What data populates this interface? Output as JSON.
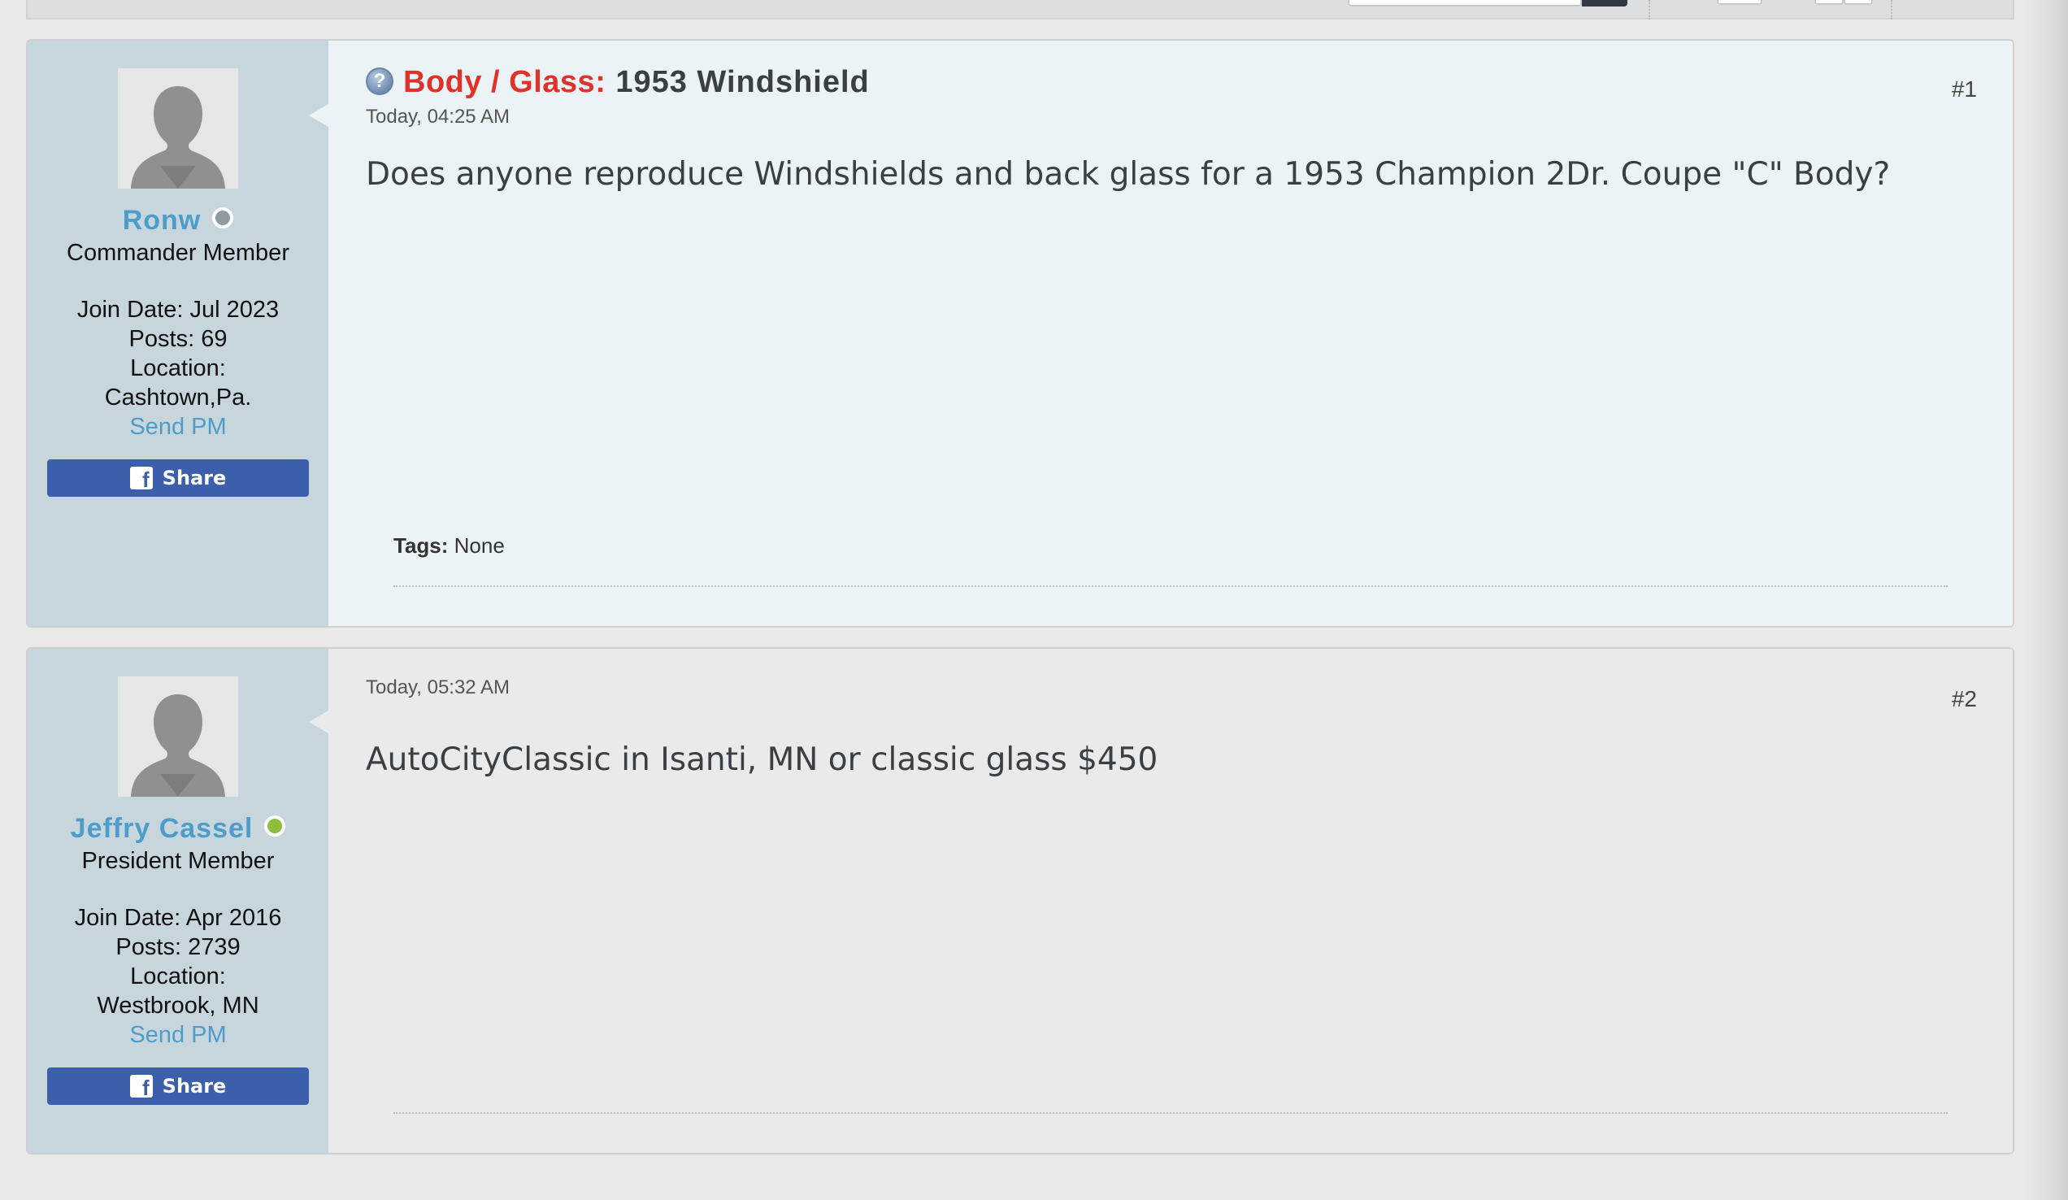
{
  "colors": {
    "username": "#4d9cc9",
    "prefix": "#e0322b",
    "share_button": "#3b5fab",
    "status_online": "#8bbf3b",
    "status_offline": "#8f9aa1"
  },
  "posts": [
    {
      "user": {
        "name": "Ronw",
        "status": "offline",
        "title": "Commander Member",
        "join_date": "Join Date: Jul 2023",
        "posts": "Posts: 69",
        "location_label": "Location:",
        "location": "Cashtown,Pa.",
        "send_pm": "Send PM"
      },
      "share_label": "Share",
      "prefix": "Body / Glass:",
      "title": "1953 Windshield",
      "date": "Today, 04:25 AM",
      "counter": "#1",
      "content": "Does anyone reproduce Windshields and back glass for a 1953 Champion 2Dr. Coupe \"C\" Body?",
      "tags_label": "Tags:",
      "tags_value": "None"
    },
    {
      "user": {
        "name": "Jeffry Cassel",
        "status": "online",
        "title": "President Member",
        "join_date": "Join Date: Apr 2016",
        "posts": "Posts: 2739",
        "location_label": "Location:",
        "location": "Westbrook, MN",
        "send_pm": "Send PM"
      },
      "share_label": "Share",
      "date": "Today, 05:32 AM",
      "counter": "#2",
      "content": "AutoCityClassic in Isanti, MN or classic glass $450"
    }
  ]
}
